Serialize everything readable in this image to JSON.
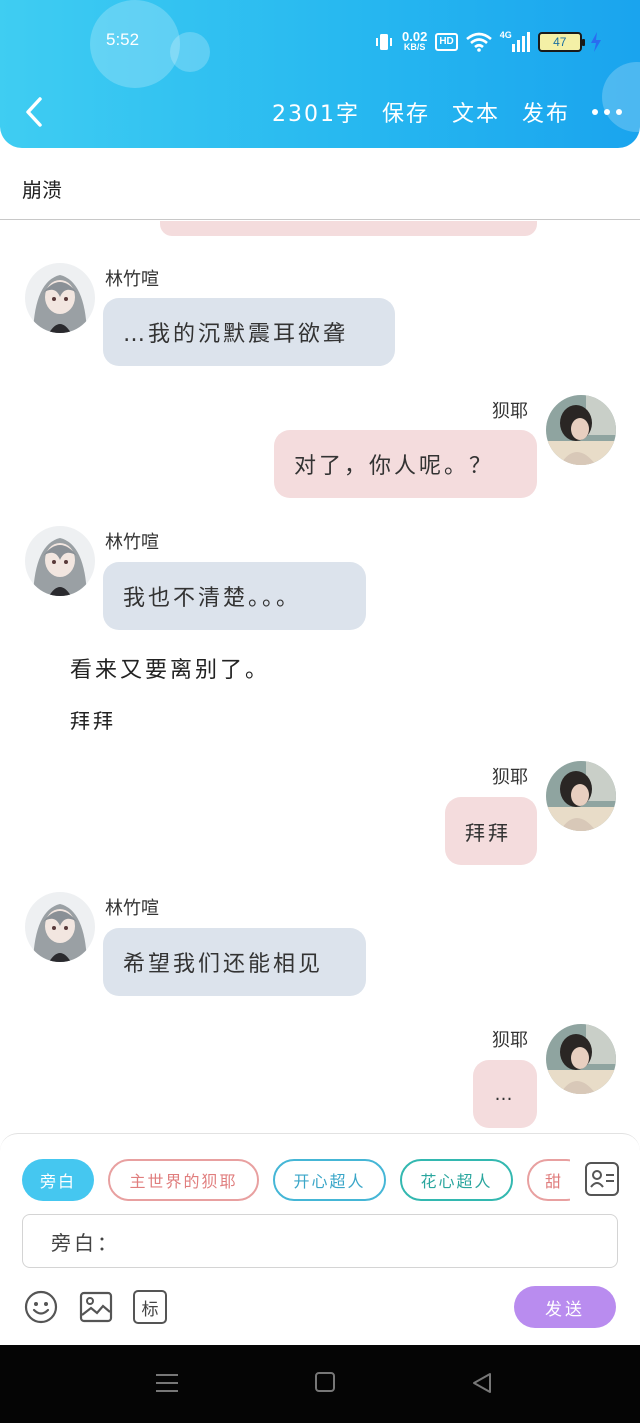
{
  "status_bar": {
    "time": "5:52",
    "speed_value": "0.02",
    "speed_unit": "KB/S",
    "hd": "HD",
    "network": "4G",
    "battery": "47"
  },
  "header": {
    "word_count": "2301字",
    "save_label": "保存",
    "text_label": "文本",
    "publish_label": "发布",
    "more_icon": "more-dots-icon",
    "back_icon": "chevron-left-icon"
  },
  "story": {
    "title": "崩溃"
  },
  "messages": [
    {
      "speaker": "林竹喧",
      "side": "left",
      "text": "…我的沉默震耳欲聋"
    },
    {
      "speaker": "狈耶",
      "side": "right",
      "text": "对了，你人呢。？"
    },
    {
      "speaker": "林竹喧",
      "side": "left",
      "text": "我也不清楚。。。"
    },
    {
      "speaker": "",
      "side": "narration",
      "text": "看来又要离别了。"
    },
    {
      "speaker": "",
      "side": "narration",
      "text": "拜拜"
    },
    {
      "speaker": "狈耶",
      "side": "right",
      "text": "拜拜"
    },
    {
      "speaker": "林竹喧",
      "side": "left",
      "text": "希望我们还能相见"
    },
    {
      "speaker": "狈耶",
      "side": "right",
      "text": "…"
    }
  ],
  "composer": {
    "characters": [
      "旁白",
      "主世界的狈耶",
      "开心超人",
      "花心超人",
      "甜"
    ],
    "input_value": "旁白：",
    "send_label": "发送",
    "tools": [
      "emoji-icon",
      "image-icon",
      "tag-icon"
    ],
    "tag_label": "标",
    "accent": "#45c7f0",
    "send_color": "#b98cef"
  }
}
